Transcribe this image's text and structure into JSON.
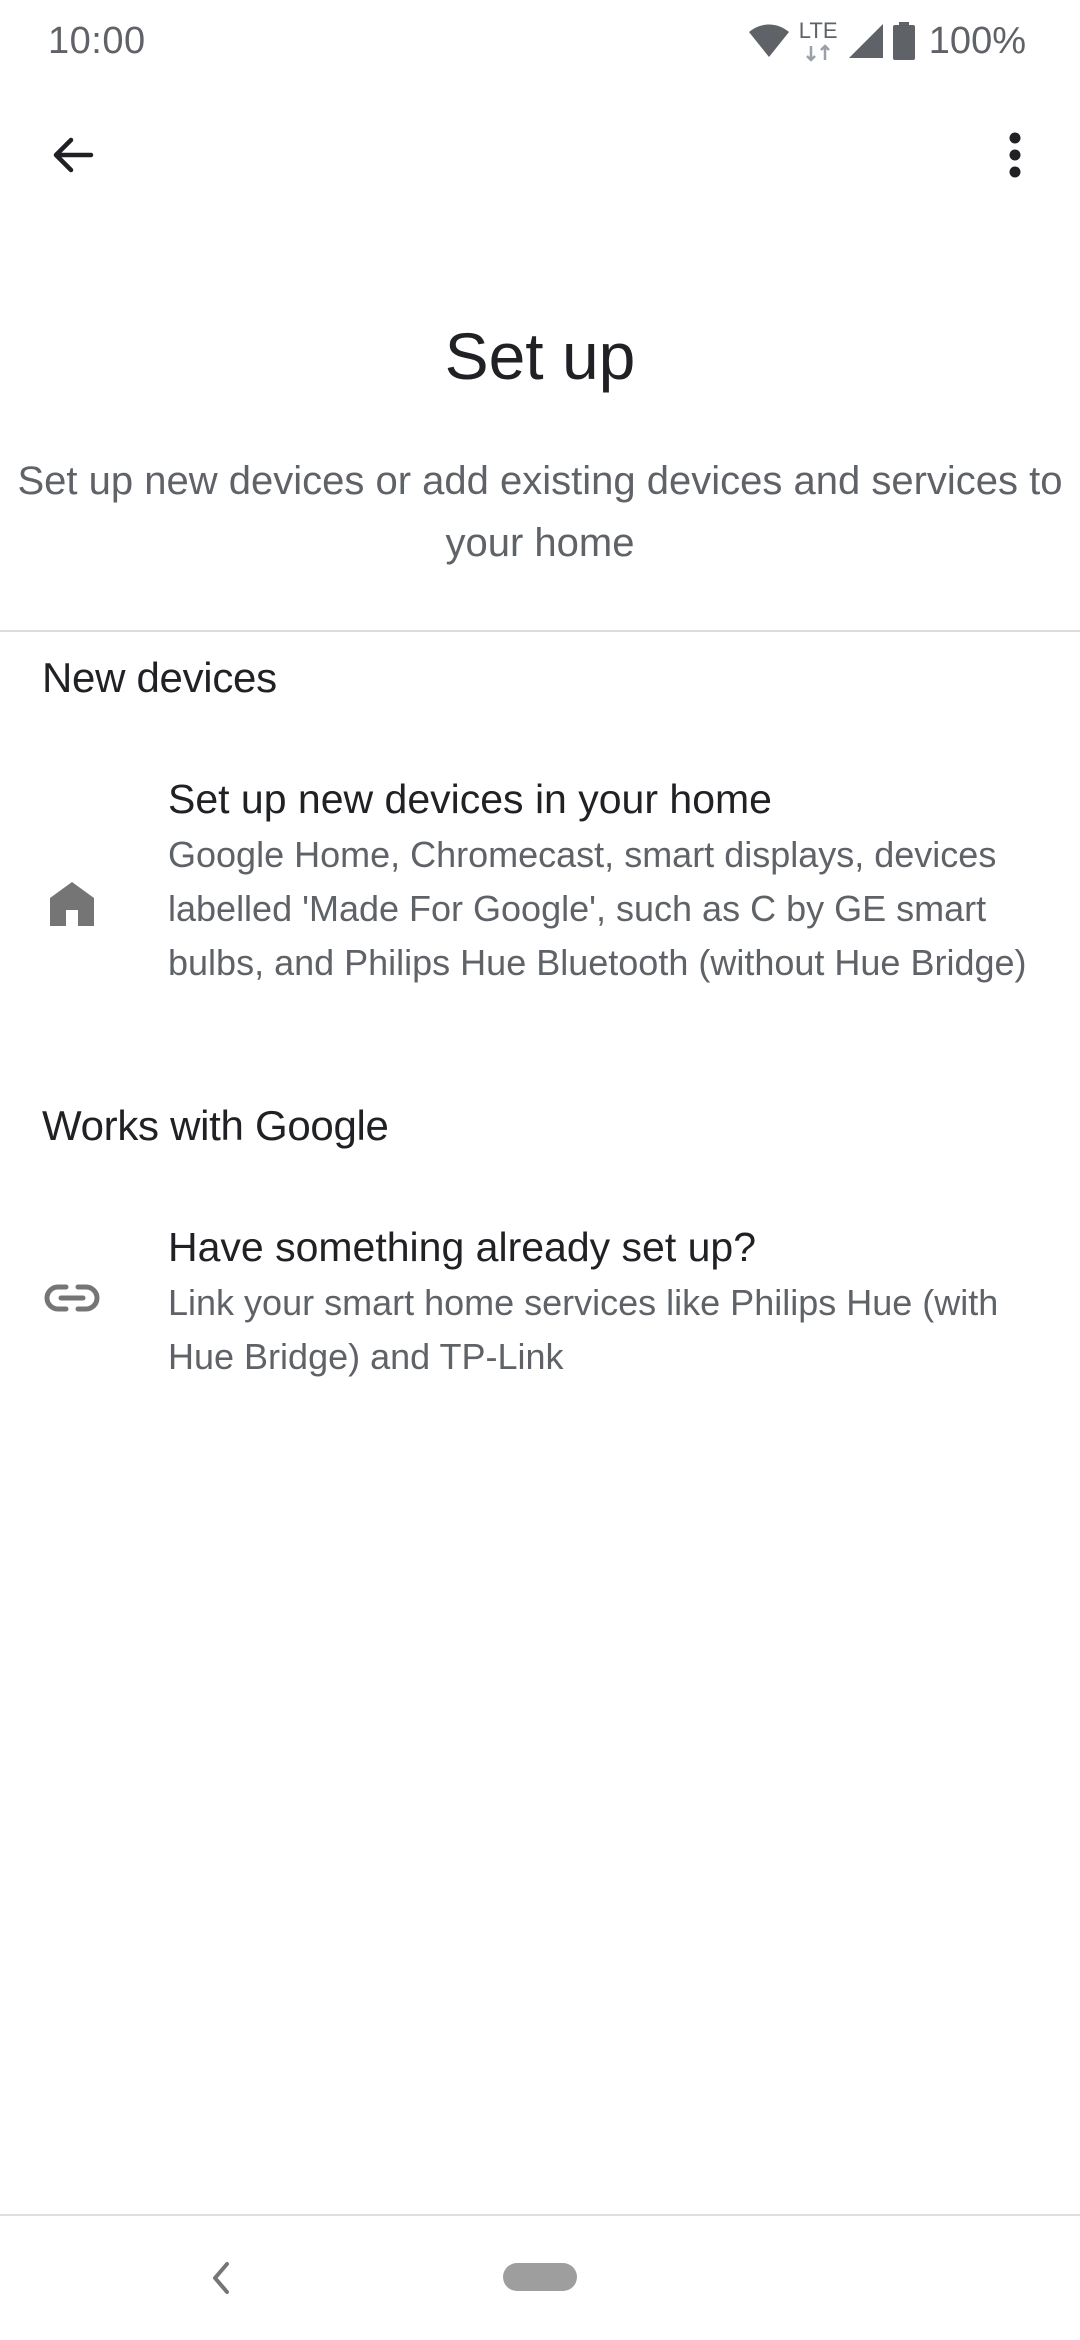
{
  "status_bar": {
    "time": "10:00",
    "network_label": "LTE",
    "battery": "100%",
    "icons": [
      "wifi-icon",
      "lte-icon",
      "signal-icon",
      "battery-icon"
    ]
  },
  "app_bar": {
    "back_icon": "arrow-back-icon",
    "more_icon": "more-vert-icon"
  },
  "header": {
    "title": "Set up",
    "subtitle": "Set up new devices or add existing devices and services to your home"
  },
  "sections": [
    {
      "title": "New devices",
      "item": {
        "icon": "home-icon",
        "title": "Set up new devices in your home",
        "description": "Google Home, Chromecast, smart displays, devices labelled 'Made For Google', such as C by GE smart bulbs, and Philips Hue Bluetooth (without Hue Bridge)"
      }
    },
    {
      "title": "Works with Google",
      "item": {
        "icon": "link-icon",
        "title": "Have something already set up?",
        "description": "Link your smart home services like Philips Hue (with Hue Bridge) and TP-Link"
      }
    }
  ],
  "nav_bar": {
    "back_icon": "nav-back-icon",
    "home_icon": "nav-home-pill"
  },
  "colors": {
    "primary_text": "#202124",
    "secondary_text": "#5f6368",
    "icon_gray": "#757575",
    "divider": "#dadce0"
  }
}
